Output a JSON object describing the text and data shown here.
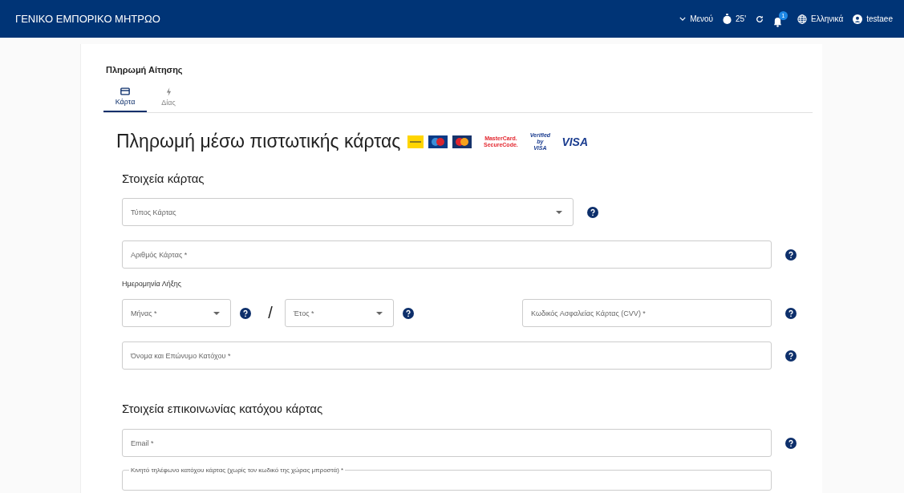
{
  "header": {
    "title": "ΓΕΝΙΚΟ ΕΜΠΟΡΙΚΟ ΜΗΤΡΩΟ",
    "menu": "Μενού",
    "timer": "25'",
    "notifications": "1",
    "language": "Ελληνικά",
    "user": "testaee"
  },
  "page_title": "Πληρωμή Αίτησης",
  "tabs": [
    {
      "label": "Κάρτα",
      "kind": "card",
      "selected": true
    },
    {
      "label": "Δίας",
      "kind": "bolt",
      "selected": false
    }
  ],
  "heading": "Πληρωμή μέσω πιστωτικής κάρτας",
  "logos": [
    {
      "kind": "yellow"
    },
    {
      "kind": "maestro"
    },
    {
      "kind": "mastercard"
    },
    {
      "kind": "securecode",
      "text": "MasterCard. SecureCode."
    },
    {
      "kind": "verified",
      "text": "Verified by VISA"
    },
    {
      "kind": "visa",
      "text": "VISA"
    }
  ],
  "card_section": {
    "title": "Στοιχεία κάρτας",
    "card_type": {
      "placeholder": "Τύπος Κάρτας"
    },
    "card_number": {
      "placeholder": "Αριθμός Κάρτας *"
    },
    "expiry_label": "Ημερομηνία Λήξης",
    "month": {
      "placeholder": "Μήνας *"
    },
    "separator": "/",
    "year": {
      "placeholder": "Έτος *"
    },
    "cvv": {
      "placeholder": "Κωδικός Ασφαλείας Κάρτας (CVV) *"
    },
    "holder": {
      "placeholder": "Όνομα και Επώνυμο Κατόχου *"
    }
  },
  "contact_section": {
    "title": "Στοιχεία επικοινωνίας κατόχου κάρτας",
    "email": {
      "placeholder": "Email *"
    },
    "phone": {
      "label": "Κινητό τηλέφωνο κατόχου κάρτας (χωρίς τον κωδικό της χώρας μπροστά) *"
    }
  }
}
